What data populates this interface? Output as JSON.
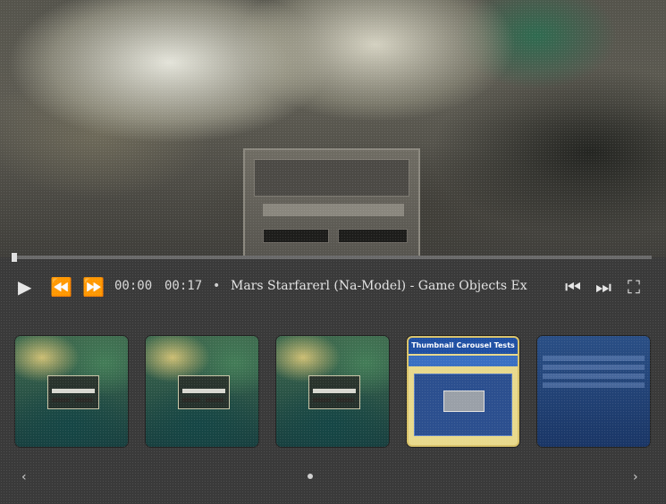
{
  "player": {
    "current_time": "00:00",
    "duration": "00:17",
    "separator": "•",
    "title": "Mars Starfarerl (Na-Model) - Game Objects Ex",
    "progress_fraction": 0.0
  },
  "controls": {
    "play_icon": "play-icon",
    "rewind_icon": "rewind-icon",
    "fast_forward_icon": "fast-forward-icon",
    "previous_icon": "previous-track-icon",
    "next_icon": "next-track-icon",
    "fullscreen_icon": "fullscreen-icon"
  },
  "playlist": {
    "items": [
      {
        "kind": "scene"
      },
      {
        "kind": "scene"
      },
      {
        "kind": "scene"
      },
      {
        "kind": "web",
        "header": "Thumbnail Carousel Tests"
      },
      {
        "kind": "list"
      }
    ],
    "nav_left_icon": "chevron-left-icon",
    "nav_right_icon": "chevron-right-icon"
  },
  "colors": {
    "accent_blue": "#1f4fa3",
    "thumb_frame": "#e8d98c",
    "background": "#3a3a3a"
  }
}
